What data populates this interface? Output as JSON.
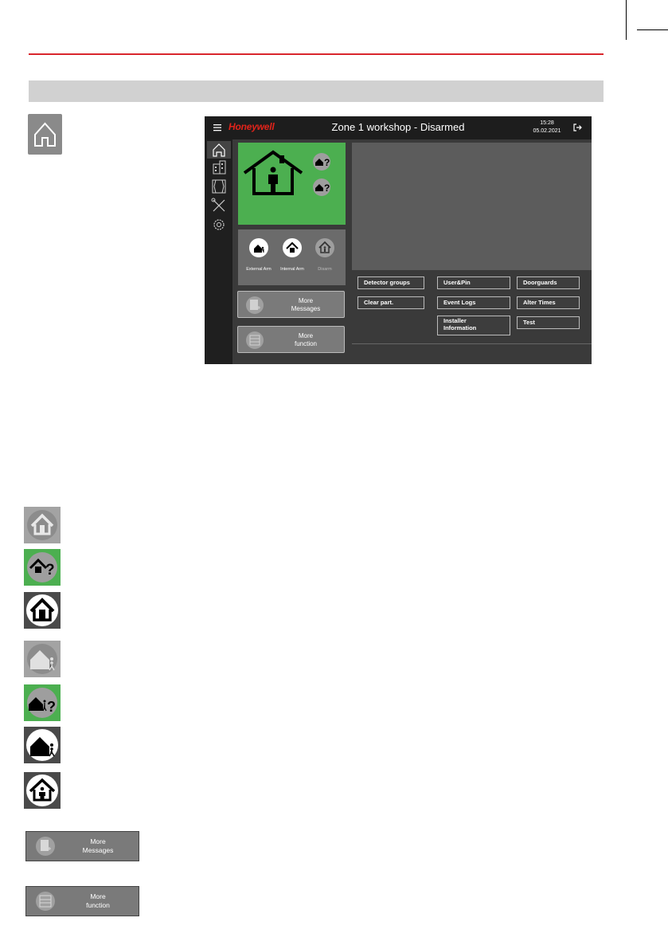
{
  "header": {
    "brand": "Honeywell",
    "title": "Zone 1 workshop - Disarmed",
    "time": "15:28",
    "date": "05.02.2021"
  },
  "sidebar": {
    "items": [
      "home-icon",
      "building-icon",
      "zones-icon",
      "tools-icon",
      "settings-icon"
    ]
  },
  "arm_panel": {
    "buttons": [
      {
        "label": "External Arm"
      },
      {
        "label": "Internal Arm"
      },
      {
        "label": "Disarm"
      }
    ]
  },
  "more_messages": {
    "line1": "More",
    "line2": "Messages"
  },
  "more_function": {
    "line1": "More",
    "line2": "function"
  },
  "action_buttons": {
    "detector_groups": "Detector groups",
    "user_pin": "User&Pin",
    "doorguards": "Doorguards",
    "clear_part": "Clear part.",
    "event_logs": "Event Logs",
    "alter_times": "Alter Times",
    "installer_line1": "Installer",
    "installer_line2": "Information",
    "test": "Test"
  },
  "legend": {
    "more_messages": {
      "line1": "More",
      "line2": "Messages"
    },
    "more_function": {
      "line1": "More",
      "line2": "function"
    }
  },
  "colors": {
    "accent_red": "#d9262c",
    "status_green": "#4caf50",
    "brand_red": "#e2231a"
  }
}
